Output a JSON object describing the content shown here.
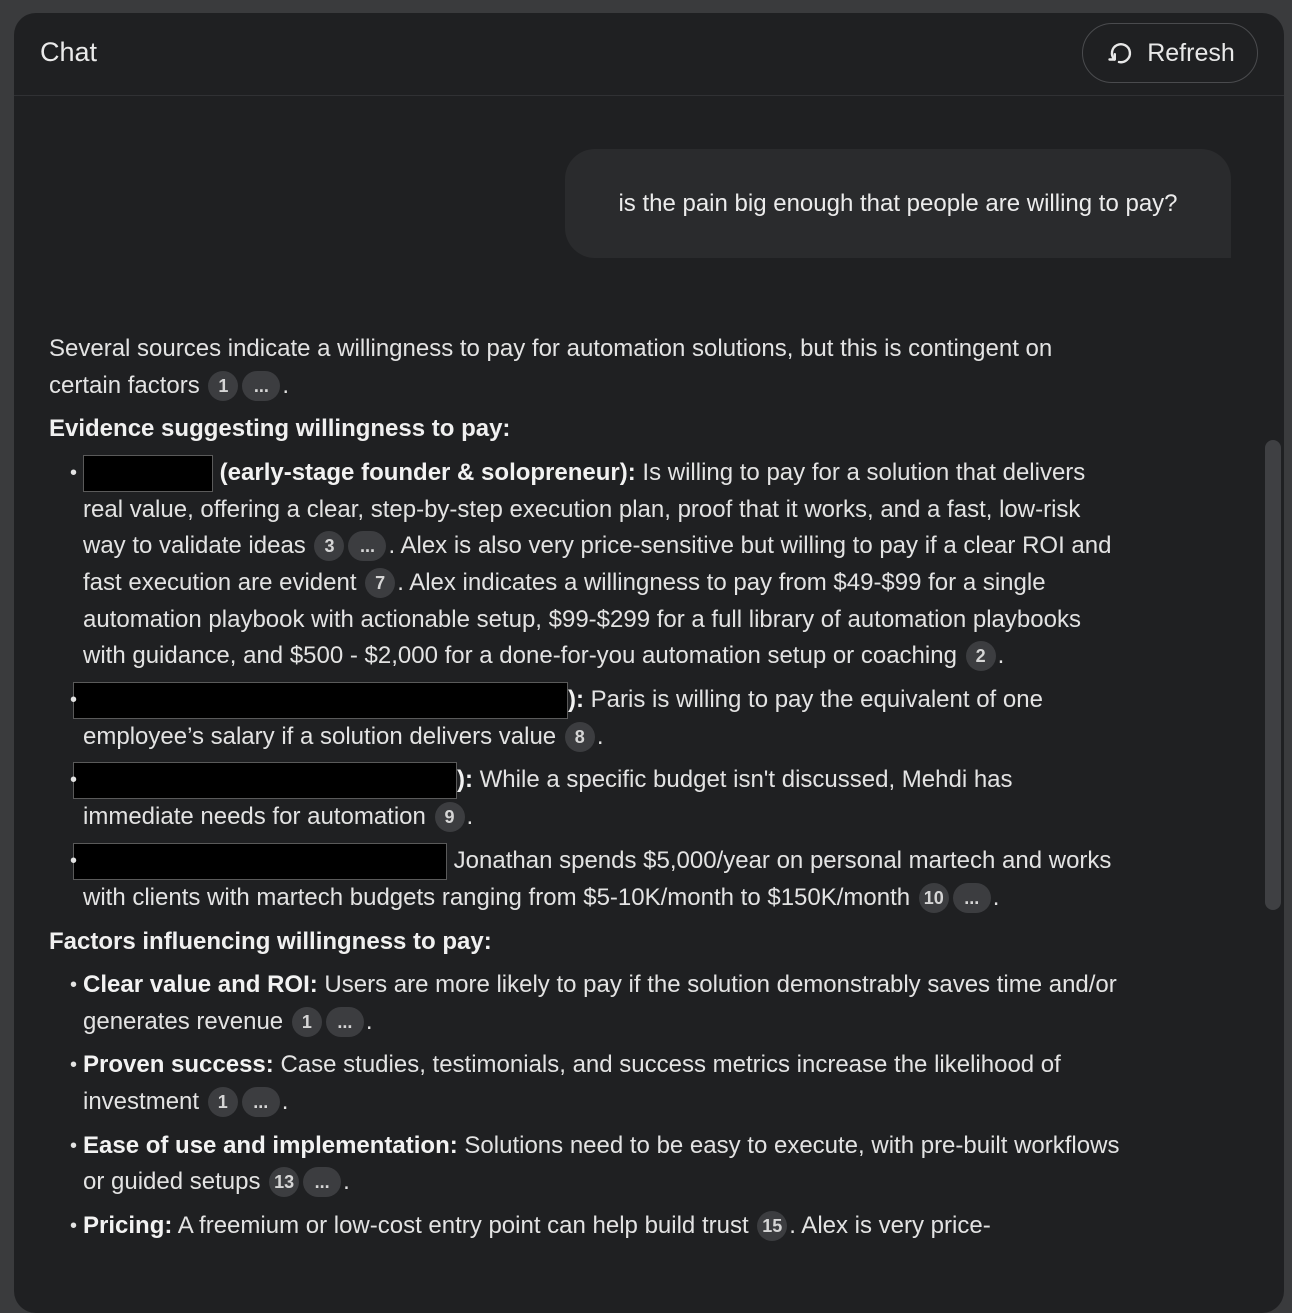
{
  "header": {
    "title": "Chat",
    "refresh_label": "Refresh"
  },
  "user_message": "is the pain big enough that people are willing to pay?",
  "answer": {
    "intro": "Several sources indicate a willingness to pay for automation solutions, but this is contingent on certain factors",
    "intro_cites": [
      "1",
      "..."
    ],
    "evidence_heading": "Evidence suggesting willingness to pay:",
    "evidence": [
      {
        "label": "(early-stage founder & solopreneur):",
        "t1": "Is willing to pay for a solution that delivers real value, offering a clear, step-by-step execution plan, proof that it works, and a fast, low-risk way to validate ideas",
        "c1": [
          "3",
          "..."
        ],
        "t2": ". Alex is also very price-sensitive but willing to pay if a clear ROI and fast execution are evident",
        "c2": [
          "7"
        ],
        "t3": ". Alex indicates a willingness to pay from $49-$99 for a single automation playbook with actionable setup, $99-$299 for a full library of automation playbooks with guidance, and $500 - $2,000 for a done-for-you automation setup or coaching",
        "c3": [
          "2"
        ]
      },
      {
        "label": "):",
        "t1": "Paris is willing to pay the equivalent of one employee’s salary if a solution delivers value",
        "c1": [
          "8"
        ]
      },
      {
        "label": "):",
        "t1": "While a specific budget isn't discussed, Mehdi has immediate needs for automation",
        "c1": [
          "9"
        ]
      },
      {
        "t1": "Jonathan spends $5,000/year on personal martech and works with clients with martech budgets ranging from $5-10K/month to $150K/month",
        "c1": [
          "10",
          "..."
        ]
      }
    ],
    "factors_heading": "Factors influencing willingness to pay:",
    "factors": [
      {
        "label": "Clear value and ROI:",
        "text": "Users are more likely to pay if the solution demonstrably saves time and/or generates revenue",
        "cites": [
          "1",
          "..."
        ]
      },
      {
        "label": "Proven success:",
        "text": "Case studies, testimonials, and success metrics increase the likelihood of investment",
        "cites": [
          "1",
          "..."
        ]
      },
      {
        "label": "Ease of use and implementation:",
        "text": "Solutions need to be easy to execute, with pre-built workflows or guided setups",
        "cites": [
          "13",
          "..."
        ]
      },
      {
        "label": "Pricing:",
        "text": "A freemium or low-cost entry point can help build trust",
        "cites": [
          "15"
        ],
        "tail": ". Alex is very price-"
      }
    ]
  },
  "colors": {
    "background": "#3a3b3d",
    "panel": "#1f2022",
    "user_bubble": "#2a2b2d",
    "citation_chip": "#3c3d40",
    "redaction": "#000000"
  },
  "icons": {
    "refresh": "refresh-icon"
  }
}
